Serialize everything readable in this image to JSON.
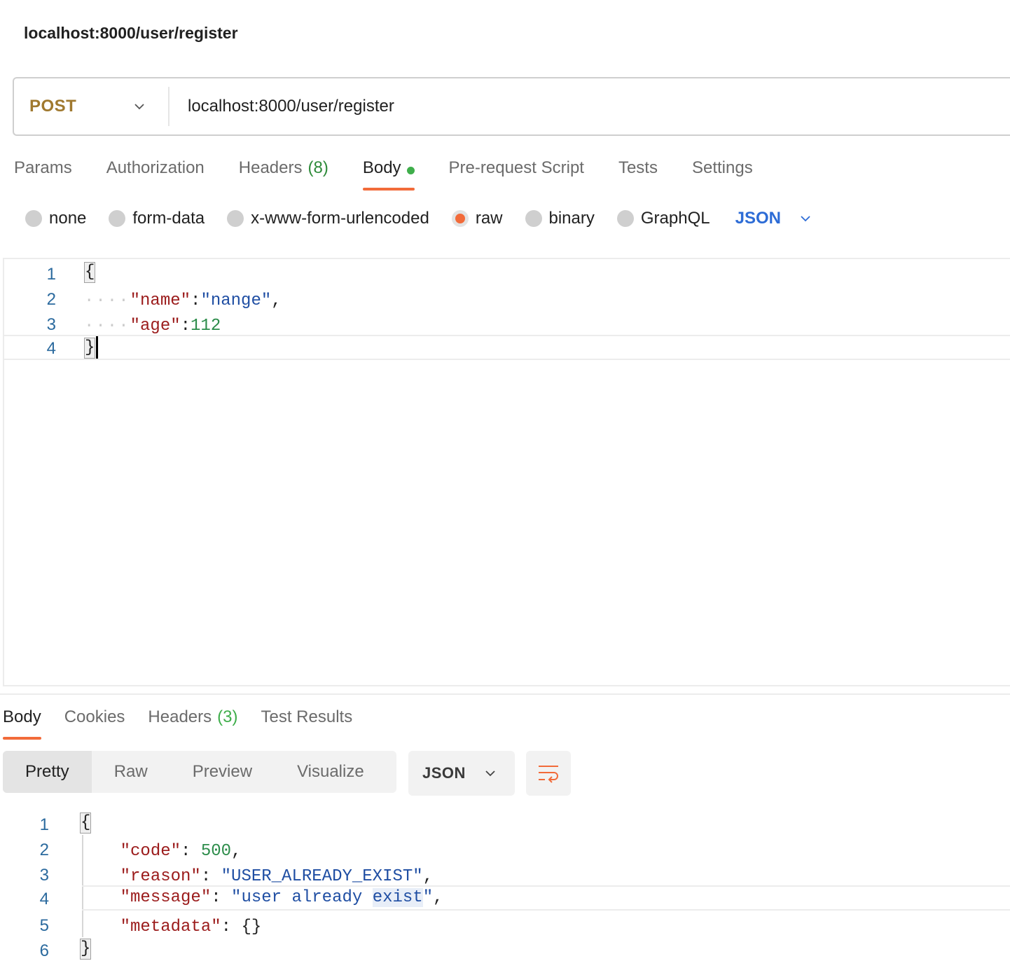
{
  "request": {
    "title": "localhost:8000/user/register",
    "method": "POST",
    "url": "localhost:8000/user/register"
  },
  "request_tabs": [
    {
      "label": "Params"
    },
    {
      "label": "Authorization"
    },
    {
      "label": "Headers",
      "count": "(8)"
    },
    {
      "label": "Body"
    },
    {
      "label": "Pre-request Script"
    },
    {
      "label": "Tests"
    },
    {
      "label": "Settings"
    }
  ],
  "body_types": [
    "none",
    "form-data",
    "x-www-form-urlencoded",
    "raw",
    "binary",
    "GraphQL"
  ],
  "body_type_selected": "raw",
  "body_language": "JSON",
  "request_body": {
    "line_numbers": [
      "1",
      "2",
      "3",
      "4"
    ],
    "open_brace": "{",
    "close_brace": "}",
    "key1": "\"name\"",
    "val1": "\"nange\"",
    "key2": "\"age\"",
    "val2": "112"
  },
  "response_tabs": [
    {
      "label": "Body"
    },
    {
      "label": "Cookies"
    },
    {
      "label": "Headers",
      "count": "(3)"
    },
    {
      "label": "Test Results"
    }
  ],
  "view_modes": [
    "Pretty",
    "Raw",
    "Preview",
    "Visualize"
  ],
  "response_language": "JSON",
  "response_body": {
    "line_numbers": [
      "1",
      "2",
      "3",
      "4",
      "5",
      "6"
    ],
    "open_brace": "{",
    "close_brace": "}",
    "code_key": "\"code\"",
    "code_val": "500",
    "reason_key": "\"reason\"",
    "reason_val": "\"USER_ALREADY_EXIST\"",
    "message_key": "\"message\"",
    "message_val_a": "\"user already ",
    "message_val_b": "exist",
    "message_val_c": "\"",
    "metadata_key": "\"metadata\"",
    "metadata_val": "{}"
  },
  "colors": {
    "accent": "#f26b3a",
    "method": "#a0792f",
    "json_key": "#9b1b1b",
    "json_string": "#1f4ea3",
    "json_number": "#2c8c4a",
    "language_select": "#2d6cd6"
  }
}
